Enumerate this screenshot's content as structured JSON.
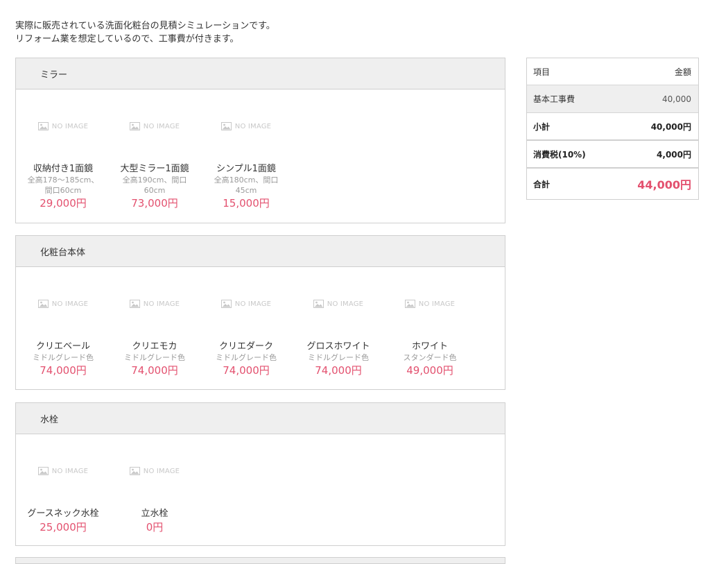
{
  "intro": {
    "line1": "実際に販売されている洗面化粧台の見積シミュレーションです。",
    "line2": "リフォーム業を想定しているので、工事費が付きます。"
  },
  "no_image_label": "NO IMAGE",
  "sections": [
    {
      "title": "ミラー",
      "items": [
        {
          "name": "収納付き1面鏡",
          "desc": "全高178～185cm、間口60cm",
          "price": "29,000円",
          "icon": "image-placeholder-icon"
        },
        {
          "name": "大型ミラー1面鏡",
          "desc": "全高190cm、間口60cm",
          "price": "73,000円",
          "icon": "image-placeholder-icon"
        },
        {
          "name": "シンプル1面鏡",
          "desc": "全高180cm、間口45cm",
          "price": "15,000円",
          "icon": "image-placeholder-icon"
        }
      ]
    },
    {
      "title": "化粧台本体",
      "items": [
        {
          "name": "クリエベール",
          "desc": "ミドルグレード色",
          "price": "74,000円",
          "icon": "image-placeholder-icon"
        },
        {
          "name": "クリエモカ",
          "desc": "ミドルグレード色",
          "price": "74,000円",
          "icon": "image-placeholder-icon"
        },
        {
          "name": "クリエダーク",
          "desc": "ミドルグレード色",
          "price": "74,000円",
          "icon": "image-placeholder-icon"
        },
        {
          "name": "グロスホワイト",
          "desc": "ミドルグレード色",
          "price": "74,000円",
          "icon": "image-placeholder-icon"
        },
        {
          "name": "ホワイト",
          "desc": "スタンダード色",
          "price": "49,000円",
          "icon": "image-placeholder-icon"
        }
      ]
    },
    {
      "title": "水栓",
      "items": [
        {
          "name": "グースネック水栓",
          "desc": "",
          "price": "25,000円",
          "icon": "image-placeholder-icon"
        },
        {
          "name": "立水栓",
          "desc": "",
          "price": "0円",
          "icon": "image-placeholder-icon"
        }
      ]
    }
  ],
  "summary": {
    "header_item": "項目",
    "header_amount": "金額",
    "base_label": "基本工事費",
    "base_value": "40,000",
    "subtotal_label": "小計",
    "subtotal_value": "40,000円",
    "tax_label": "消費税(10%)",
    "tax_value": "4,000円",
    "total_label": "合計",
    "total_value": "44,000円"
  },
  "colors": {
    "price": "#e3516f",
    "section_header_bg": "#efefef",
    "border": "#cfcfcf"
  }
}
